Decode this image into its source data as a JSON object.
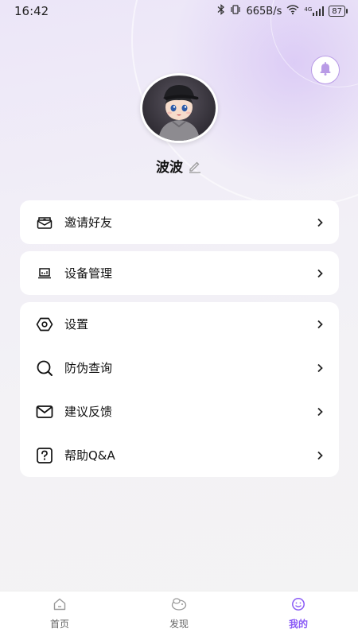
{
  "status_bar": {
    "time": "16:42",
    "net_speed": "665B/s",
    "network_type": "4G",
    "battery": "87"
  },
  "profile": {
    "username": "波波"
  },
  "menu": {
    "invite": "邀请好友",
    "device": "设备管理",
    "settings": "设置",
    "anti_fake": "防伪查询",
    "feedback": "建议反馈",
    "help": "帮助Q&A"
  },
  "nav": {
    "items": [
      {
        "label": "首页",
        "icon": "home-icon"
      },
      {
        "label": "发现",
        "icon": "discover-icon"
      },
      {
        "label": "我的",
        "icon": "profile-icon"
      }
    ],
    "active_color": "#8b5cf6"
  }
}
